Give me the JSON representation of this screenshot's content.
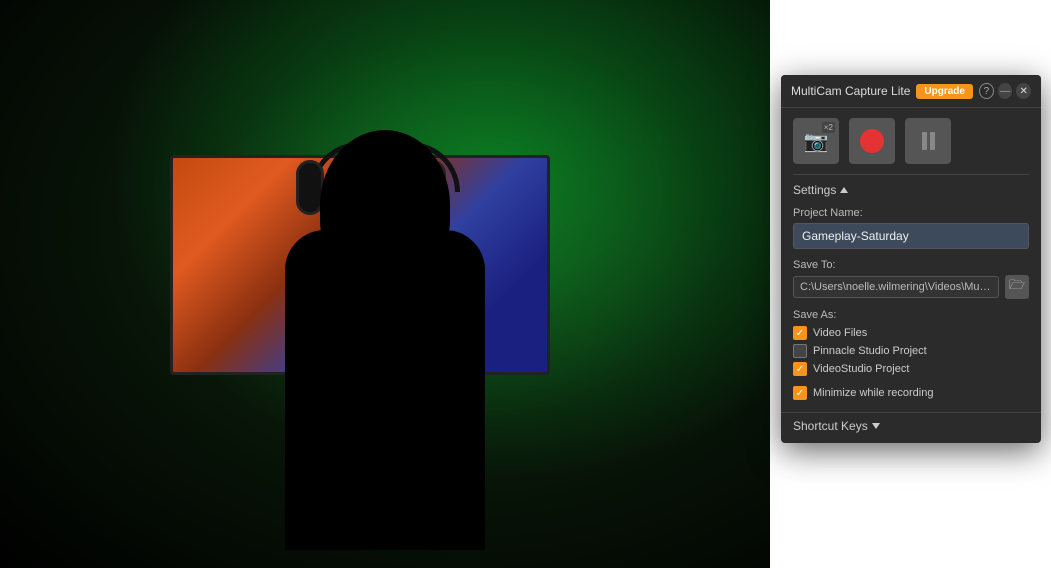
{
  "background": {
    "alt": "Gamer silhouette with green backlight"
  },
  "app": {
    "title": "MultiCam Capture Lite",
    "upgrade_label": "Upgrade",
    "help_label": "?",
    "minimize_label": "—",
    "close_label": "✕",
    "toolbar": {
      "settings_badge": "×2",
      "record_aria": "Record",
      "pause_aria": "Pause"
    },
    "settings_section": {
      "header": "Settings",
      "arrow": "▲",
      "project_name_label": "Project Name:",
      "project_name_value": "Gameplay-Saturday",
      "save_to_label": "Save To:",
      "save_to_path": "C:\\Users\\noelle.wilmering\\Videos\\Multi...",
      "save_as_label": "Save As:",
      "save_as_options": [
        {
          "label": "Video Files",
          "checked": true
        },
        {
          "label": "Pinnacle Studio Project",
          "checked": false
        },
        {
          "label": "VideoStudio Project",
          "checked": true
        }
      ],
      "minimize_label": "Minimize while recording",
      "minimize_checked": true
    },
    "shortcut_keys": {
      "label": "Shortcut Keys",
      "arrow": "▼"
    }
  }
}
